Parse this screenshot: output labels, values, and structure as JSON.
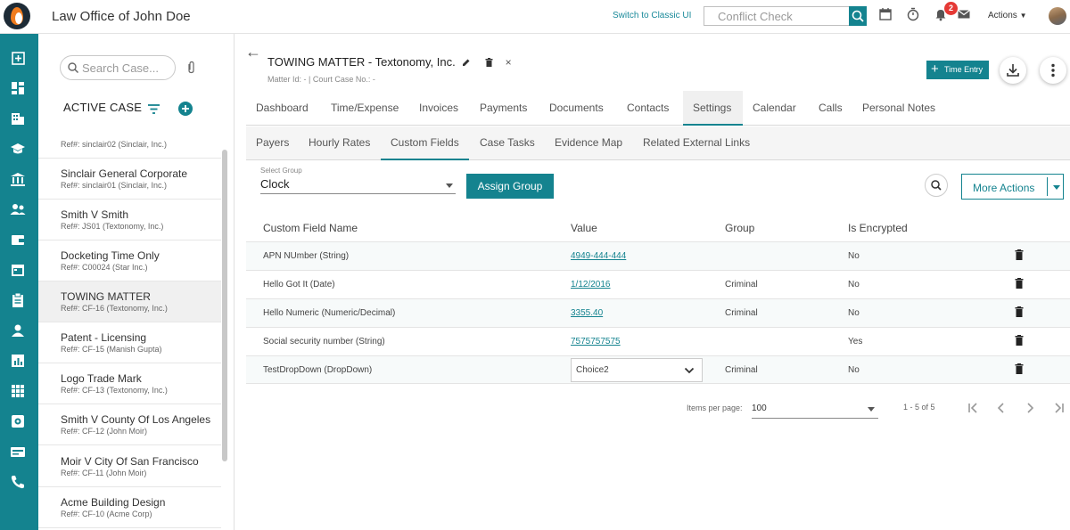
{
  "header": {
    "app_title": "Law Office of John Doe",
    "switch_link": "Switch to Classic UI",
    "conflict_placeholder": "Conflict Check",
    "notification_count": "2",
    "actions_label": "Actions"
  },
  "sidebar": {
    "search_placeholder": "Search Case...",
    "section_label": "ACTIVE CASE",
    "cases": [
      {
        "name": "",
        "ref": "Ref#: sinclair02 (Sinclair, Inc.)"
      },
      {
        "name": "Sinclair General Corporate",
        "ref": "Ref#: sinclair01 (Sinclair, Inc.)"
      },
      {
        "name": "Smith V Smith",
        "ref": "Ref#: JS01 (Textonomy, Inc.)"
      },
      {
        "name": "Docketing Time Only",
        "ref": "Ref#: C00024 (Star Inc.)"
      },
      {
        "name": "TOWING MATTER",
        "ref": "Ref#: CF-16 (Textonomy, Inc.)"
      },
      {
        "name": "Patent - Licensing",
        "ref": "Ref#: CF-15 (Manish Gupta)"
      },
      {
        "name": "Logo Trade Mark",
        "ref": "Ref#: CF-13 (Textonomy, Inc.)"
      },
      {
        "name": "Smith V County Of Los Angeles",
        "ref": "Ref#: CF-12 (John Moir)"
      },
      {
        "name": "Moir V City Of San Francisco",
        "ref": "Ref#: CF-11 (John Moir)"
      },
      {
        "name": "Acme Building Design",
        "ref": "Ref#: CF-10 (Acme Corp)"
      }
    ]
  },
  "matter": {
    "title": "TOWING MATTER - Textonomy, Inc.",
    "subtitle": "Matter Id: - | Court Case No.: -",
    "time_entry_label": "Time Entry"
  },
  "tabs": [
    "Dashboard",
    "Time/Expense",
    "Invoices",
    "Payments",
    "Documents",
    "Contacts",
    "Settings",
    "Calendar",
    "Calls",
    "Personal Notes"
  ],
  "subtabs": [
    "Payers",
    "Hourly Rates",
    "Custom Fields",
    "Case Tasks",
    "Evidence Map",
    "Related External Links"
  ],
  "group": {
    "label": "Select Group",
    "value": "Clock",
    "assign_label": "Assign Group",
    "more_actions_label": "More Actions"
  },
  "table": {
    "headers": [
      "Custom Field Name",
      "Value",
      "Group",
      "Is Encrypted"
    ],
    "rows": [
      {
        "name": "APN NUmber (String)",
        "value": "4949-444-444",
        "group": "",
        "encrypted": "No"
      },
      {
        "name": "Hello Got It (Date)",
        "value": "1/12/2016",
        "group": "Criminal",
        "encrypted": "No"
      },
      {
        "name": "Hello Numeric (Numeric/Decimal)",
        "value": "3355.40",
        "group": "Criminal",
        "encrypted": "No"
      },
      {
        "name": "Social security number (String)",
        "value": "7575757575",
        "group": "",
        "encrypted": "Yes"
      },
      {
        "name": "TestDropDown (DropDown)",
        "value": "Choice2",
        "group": "Criminal",
        "encrypted": "No"
      }
    ]
  },
  "pager": {
    "label": "Items per page:",
    "per_page": "100",
    "range": "1 - 5 of 5"
  },
  "colors": {
    "accent": "#14838f",
    "badge": "#e53935"
  }
}
